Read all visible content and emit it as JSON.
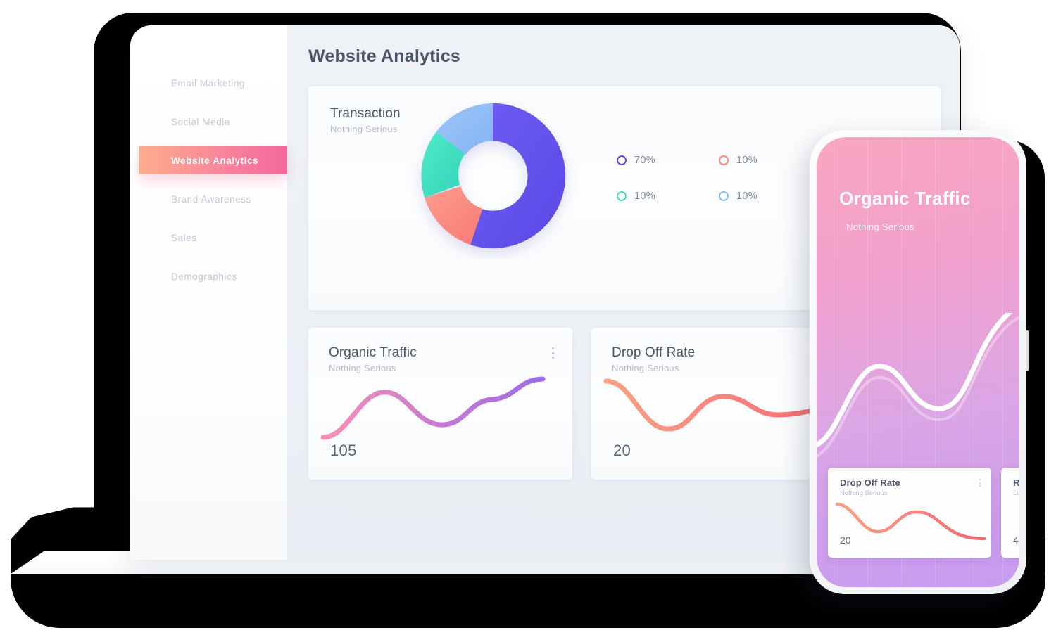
{
  "laptop": {
    "sidebar": {
      "items": [
        {
          "label": "Email Marketing",
          "active": false
        },
        {
          "label": "Social Media",
          "active": false
        },
        {
          "label": "Website Analytics",
          "active": true
        },
        {
          "label": "Brand Awareness",
          "active": false
        },
        {
          "label": "Sales",
          "active": false
        },
        {
          "label": "Demographics",
          "active": false
        }
      ],
      "menu_icon": "hamburger-icon"
    },
    "page_title": "Website Analytics",
    "transaction_card": {
      "title": "Transaction",
      "subtitle": "Nothing Serious",
      "legend": [
        {
          "value": "70%",
          "color": "#5f51e8"
        },
        {
          "value": "10%",
          "color": "#fb8a80"
        },
        {
          "value": "10%",
          "color": "#3fdfc0"
        },
        {
          "value": "10%",
          "color": "#8fbcf5"
        }
      ]
    },
    "organic_traffic_card": {
      "title": "Organic Traffic",
      "subtitle": "Nothing Serious",
      "value": "105",
      "menu_icon": "more-vertical-icon",
      "line_start_color": "#f98fb4",
      "line_end_color": "#9d6ce8"
    },
    "drop_off_card": {
      "title": "Drop Off Rate",
      "subtitle": "Nothing Serious",
      "value": "20",
      "line_start_color": "#f9a183",
      "line_end_color": "#f4676f"
    }
  },
  "phone": {
    "title": "Organic Traffic",
    "subtitle": "Nothing Serious",
    "gradient_start": "#f9a6c2",
    "gradient_end": "#c79bf0",
    "cards": [
      {
        "title": "Drop Off Rate",
        "subtitle": "Nothing Serious",
        "value": "20",
        "menu_icon": "more-vertical-icon"
      },
      {
        "title": "R",
        "subtitle": "Lo",
        "value": "4",
        "menu_icon": "more-vertical-icon"
      }
    ]
  },
  "chart_data": [
    {
      "type": "pie",
      "title": "Transaction",
      "subtitle": "Nothing Serious",
      "variant": "donut",
      "labels": [
        "70%",
        "10%",
        "10%",
        "10%"
      ],
      "values": [
        70,
        10,
        10,
        10
      ],
      "colors": [
        "#5f51e8",
        "#fb8a80",
        "#3fdfc0",
        "#8fbcf5"
      ],
      "legend_position": "right"
    },
    {
      "type": "line",
      "title": "Organic Traffic",
      "subtitle": "Nothing Serious",
      "display_value": "105",
      "x": [
        0,
        1,
        2,
        3,
        4,
        5,
        6
      ],
      "values": [
        12,
        18,
        58,
        70,
        38,
        34,
        82
      ],
      "grid": false,
      "line_gradient": [
        "#f98fb4",
        "#9d6ce8"
      ]
    },
    {
      "type": "line",
      "title": "Drop Off Rate",
      "subtitle": "Nothing Serious",
      "display_value": "20",
      "x": [
        0,
        1,
        2,
        3,
        4,
        5,
        6
      ],
      "values": [
        78,
        70,
        32,
        12,
        40,
        58,
        56
      ],
      "grid": false,
      "line_gradient": [
        "#f9a183",
        "#f4676f"
      ]
    },
    {
      "type": "line",
      "title": "Organic Traffic",
      "subtitle": "Nothing Serious",
      "context": "phone-hero",
      "x": [
        0,
        1,
        2,
        3,
        4,
        5,
        6
      ],
      "values": [
        8,
        26,
        72,
        80,
        50,
        44,
        95
      ],
      "grid": true,
      "line_color": "#ffffff"
    },
    {
      "type": "line",
      "title": "Drop Off Rate",
      "subtitle": "Nothing Serious",
      "context": "phone-card",
      "display_value": "20",
      "x": [
        0,
        1,
        2,
        3,
        4,
        5,
        6
      ],
      "values": [
        80,
        72,
        26,
        18,
        62,
        70,
        20
      ],
      "grid": false,
      "line_gradient": [
        "#f9a183",
        "#f4676f"
      ]
    }
  ]
}
